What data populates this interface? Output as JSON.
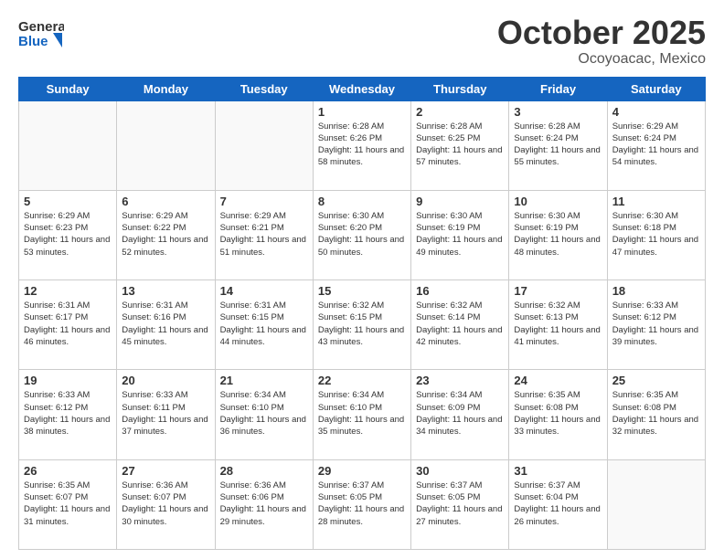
{
  "header": {
    "logo_line1": "General",
    "logo_line2": "Blue",
    "month": "October 2025",
    "location": "Ocoyoacac, Mexico"
  },
  "weekdays": [
    "Sunday",
    "Monday",
    "Tuesday",
    "Wednesday",
    "Thursday",
    "Friday",
    "Saturday"
  ],
  "weeks": [
    [
      {
        "day": "",
        "info": ""
      },
      {
        "day": "",
        "info": ""
      },
      {
        "day": "",
        "info": ""
      },
      {
        "day": "1",
        "info": "Sunrise: 6:28 AM\nSunset: 6:26 PM\nDaylight: 11 hours\nand 58 minutes."
      },
      {
        "day": "2",
        "info": "Sunrise: 6:28 AM\nSunset: 6:25 PM\nDaylight: 11 hours\nand 57 minutes."
      },
      {
        "day": "3",
        "info": "Sunrise: 6:28 AM\nSunset: 6:24 PM\nDaylight: 11 hours\nand 55 minutes."
      },
      {
        "day": "4",
        "info": "Sunrise: 6:29 AM\nSunset: 6:24 PM\nDaylight: 11 hours\nand 54 minutes."
      }
    ],
    [
      {
        "day": "5",
        "info": "Sunrise: 6:29 AM\nSunset: 6:23 PM\nDaylight: 11 hours\nand 53 minutes."
      },
      {
        "day": "6",
        "info": "Sunrise: 6:29 AM\nSunset: 6:22 PM\nDaylight: 11 hours\nand 52 minutes."
      },
      {
        "day": "7",
        "info": "Sunrise: 6:29 AM\nSunset: 6:21 PM\nDaylight: 11 hours\nand 51 minutes."
      },
      {
        "day": "8",
        "info": "Sunrise: 6:30 AM\nSunset: 6:20 PM\nDaylight: 11 hours\nand 50 minutes."
      },
      {
        "day": "9",
        "info": "Sunrise: 6:30 AM\nSunset: 6:19 PM\nDaylight: 11 hours\nand 49 minutes."
      },
      {
        "day": "10",
        "info": "Sunrise: 6:30 AM\nSunset: 6:19 PM\nDaylight: 11 hours\nand 48 minutes."
      },
      {
        "day": "11",
        "info": "Sunrise: 6:30 AM\nSunset: 6:18 PM\nDaylight: 11 hours\nand 47 minutes."
      }
    ],
    [
      {
        "day": "12",
        "info": "Sunrise: 6:31 AM\nSunset: 6:17 PM\nDaylight: 11 hours\nand 46 minutes."
      },
      {
        "day": "13",
        "info": "Sunrise: 6:31 AM\nSunset: 6:16 PM\nDaylight: 11 hours\nand 45 minutes."
      },
      {
        "day": "14",
        "info": "Sunrise: 6:31 AM\nSunset: 6:15 PM\nDaylight: 11 hours\nand 44 minutes."
      },
      {
        "day": "15",
        "info": "Sunrise: 6:32 AM\nSunset: 6:15 PM\nDaylight: 11 hours\nand 43 minutes."
      },
      {
        "day": "16",
        "info": "Sunrise: 6:32 AM\nSunset: 6:14 PM\nDaylight: 11 hours\nand 42 minutes."
      },
      {
        "day": "17",
        "info": "Sunrise: 6:32 AM\nSunset: 6:13 PM\nDaylight: 11 hours\nand 41 minutes."
      },
      {
        "day": "18",
        "info": "Sunrise: 6:33 AM\nSunset: 6:12 PM\nDaylight: 11 hours\nand 39 minutes."
      }
    ],
    [
      {
        "day": "19",
        "info": "Sunrise: 6:33 AM\nSunset: 6:12 PM\nDaylight: 11 hours\nand 38 minutes."
      },
      {
        "day": "20",
        "info": "Sunrise: 6:33 AM\nSunset: 6:11 PM\nDaylight: 11 hours\nand 37 minutes."
      },
      {
        "day": "21",
        "info": "Sunrise: 6:34 AM\nSunset: 6:10 PM\nDaylight: 11 hours\nand 36 minutes."
      },
      {
        "day": "22",
        "info": "Sunrise: 6:34 AM\nSunset: 6:10 PM\nDaylight: 11 hours\nand 35 minutes."
      },
      {
        "day": "23",
        "info": "Sunrise: 6:34 AM\nSunset: 6:09 PM\nDaylight: 11 hours\nand 34 minutes."
      },
      {
        "day": "24",
        "info": "Sunrise: 6:35 AM\nSunset: 6:08 PM\nDaylight: 11 hours\nand 33 minutes."
      },
      {
        "day": "25",
        "info": "Sunrise: 6:35 AM\nSunset: 6:08 PM\nDaylight: 11 hours\nand 32 minutes."
      }
    ],
    [
      {
        "day": "26",
        "info": "Sunrise: 6:35 AM\nSunset: 6:07 PM\nDaylight: 11 hours\nand 31 minutes."
      },
      {
        "day": "27",
        "info": "Sunrise: 6:36 AM\nSunset: 6:07 PM\nDaylight: 11 hours\nand 30 minutes."
      },
      {
        "day": "28",
        "info": "Sunrise: 6:36 AM\nSunset: 6:06 PM\nDaylight: 11 hours\nand 29 minutes."
      },
      {
        "day": "29",
        "info": "Sunrise: 6:37 AM\nSunset: 6:05 PM\nDaylight: 11 hours\nand 28 minutes."
      },
      {
        "day": "30",
        "info": "Sunrise: 6:37 AM\nSunset: 6:05 PM\nDaylight: 11 hours\nand 27 minutes."
      },
      {
        "day": "31",
        "info": "Sunrise: 6:37 AM\nSunset: 6:04 PM\nDaylight: 11 hours\nand 26 minutes."
      },
      {
        "day": "",
        "info": ""
      }
    ]
  ]
}
